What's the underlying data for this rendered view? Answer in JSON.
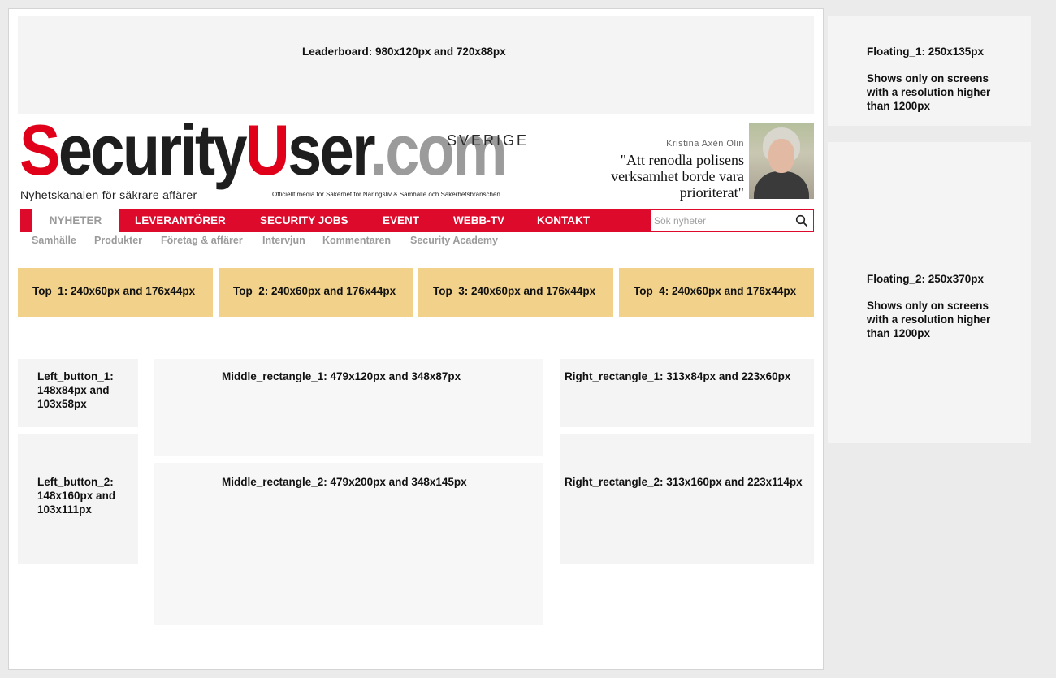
{
  "leaderboard": "Leaderboard: 980x120px and 720x88px",
  "floating_1": {
    "title": "Floating_1: 250x135px",
    "note": "Shows only on screens with a resolution higher than 1200px"
  },
  "floating_2": {
    "title": "Floating_2: 250x370px",
    "note": "Shows only on screens with a resolution higher than 1200px"
  },
  "logo": {
    "security": "Security",
    "s_first": "S",
    "ecurity": "ecurity",
    "u_first": "U",
    "ser": "ser",
    "dotcom": ".com",
    "sverige": "SVERIGE",
    "tagline": "Nyhetskanalen för säkrare affärer",
    "sub": "Officiellt media för Säkerhet för Näringsliv & Samhälle och Säkerhetsbranschen"
  },
  "promo": {
    "author": "Kristina Axén Olin",
    "quote": "\"Att renodla polisens verksamhet borde vara prioriterat\""
  },
  "nav": {
    "active": "NYHETER",
    "items": [
      "LEVERANTÖRER",
      "SECURITY JOBS",
      "EVENT",
      "WEBB-TV",
      "KONTAKT"
    ],
    "search_placeholder": "Sök nyheter"
  },
  "subnav": [
    "Samhälle",
    "Produkter",
    "Företag & affärer",
    "Intervjun",
    "Kommentaren",
    "Security Academy"
  ],
  "tops": [
    "Top_1: 240x60px and 176x44px",
    "Top_2: 240x60px and 176x44px",
    "Top_3: 240x60px and 176x44px",
    "Top_4: 240x60px and 176x44px"
  ],
  "left_button_1": "Left_button_1: 148x84px and 103x58px",
  "left_button_2": "Left_button_2: 148x160px and 103x111px",
  "middle_rectangle_1": "Middle_rectangle_1: 479x120px and 348x87px",
  "middle_rectangle_2": "Middle_rectangle_2: 479x200px and 348x145px",
  "right_rectangle_1": "Right_rectangle_1: 313x84px and 223x60px",
  "right_rectangle_2": "Right_rectangle_2: 313x160px and 223x114px",
  "colors": {
    "brand_red": "#de0a2c",
    "ad_yellow": "#f2d28a",
    "ad_gray": "#f4f4f4"
  }
}
